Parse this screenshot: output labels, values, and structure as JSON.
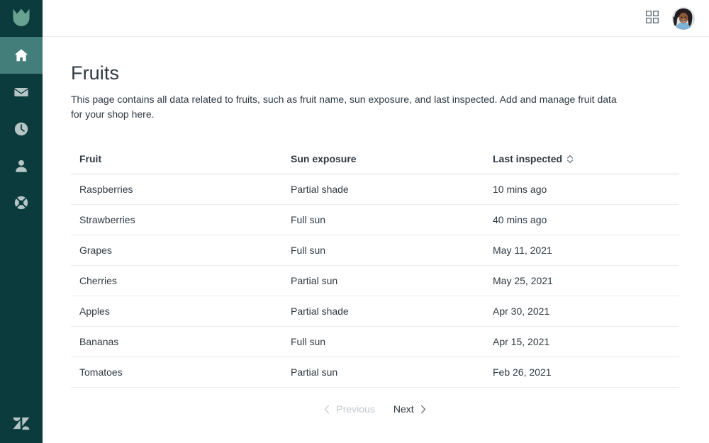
{
  "sidebar": {
    "logo": {
      "name": "garden-leaf-logo",
      "color": "#68a391"
    },
    "background_color": "#0b3b3c",
    "active_item_color": "#437e7b",
    "items": [
      {
        "label": "Home",
        "icon": "home-icon",
        "active": true
      },
      {
        "label": "Messages",
        "icon": "mail-icon",
        "active": false
      },
      {
        "label": "Recents",
        "icon": "clock-icon",
        "active": false
      },
      {
        "label": "Profile",
        "icon": "person-icon",
        "active": false
      },
      {
        "label": "Support",
        "icon": "lifebuoy-icon",
        "active": false
      }
    ],
    "footer_logo": {
      "name": "zendesk-logo",
      "label": "Zendesk"
    }
  },
  "topbar": {
    "grid_button_label": "Products",
    "grid_icon": "grid-apps-icon",
    "avatar_label": "User avatar"
  },
  "page": {
    "title": "Fruits",
    "description": "This page contains all data related to fruits, such as fruit name, sun exposure, and last inspected. Add and manage fruit data for your shop here."
  },
  "table": {
    "columns": [
      {
        "label": "Fruit",
        "sortable": false
      },
      {
        "label": "Sun exposure",
        "sortable": false
      },
      {
        "label": "Last inspected",
        "sortable": true,
        "sort_icon": "sort-updown-icon"
      }
    ],
    "rows": [
      {
        "fruit": "Raspberries",
        "sun_exposure": "Partial shade",
        "last_inspected": "10 mins ago"
      },
      {
        "fruit": "Strawberries",
        "sun_exposure": "Full sun",
        "last_inspected": "40 mins ago"
      },
      {
        "fruit": "Grapes",
        "sun_exposure": "Full sun",
        "last_inspected": "May 11, 2021"
      },
      {
        "fruit": "Cherries",
        "sun_exposure": "Partial sun",
        "last_inspected": "May 25, 2021"
      },
      {
        "fruit": "Apples",
        "sun_exposure": "Partial shade",
        "last_inspected": "Apr 30, 2021"
      },
      {
        "fruit": "Bananas",
        "sun_exposure": "Full sun",
        "last_inspected": "Apr 15, 2021"
      },
      {
        "fruit": "Tomatoes",
        "sun_exposure": "Partial sun",
        "last_inspected": "Feb 26, 2021"
      }
    ]
  },
  "pagination": {
    "previous_label": "Previous",
    "previous_disabled": true,
    "next_label": "Next",
    "next_disabled": false
  },
  "colors": {
    "text": "#2f3941",
    "muted_text": "#c2c8cc",
    "border": "#e9ebed",
    "header_border": "#d8dcde",
    "sidebar": "#0b3b3c",
    "sidebar_active": "#437e7b",
    "icon": "#b5c4c4"
  }
}
